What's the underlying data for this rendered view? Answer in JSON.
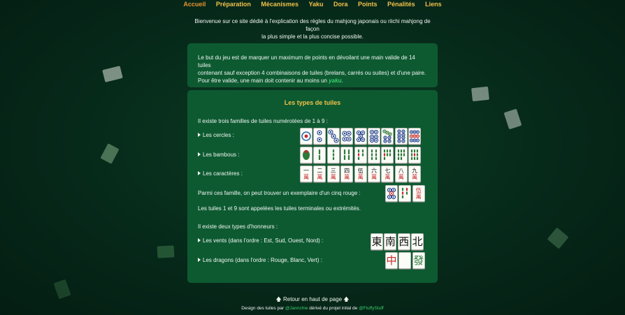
{
  "nav": [
    {
      "label": "Accueil",
      "active": true
    },
    {
      "label": "Préparation"
    },
    {
      "label": "Mécanismes"
    },
    {
      "label": "Yaku"
    },
    {
      "label": "Dora"
    },
    {
      "label": "Points"
    },
    {
      "label": "Pénalités"
    },
    {
      "label": "Liens"
    }
  ],
  "intro": {
    "line1": "Bienvenue sur ce site dédié à l'explication des règles du mahjong japonais ou riichi mahjong de façon",
    "line2": "la plus simple et la plus concise possible."
  },
  "goal": {
    "line1": "Le but du jeu est de marquer un maximum de points en dévoilant une main valide de 14 tuiles",
    "line2": "contenant sauf exception 4 combinaisons de tuiles (brelans, carrés ou suites) et d'une paire.",
    "line3_before": "Pour être valide, une main doit contenir au moins un ",
    "line3_yaku": "yaku",
    "line3_after": "."
  },
  "tiles_section": {
    "title": "Les types de tuiles",
    "families_intro": "Il existe trois familles de tuiles numérotées de 1 à 9 :",
    "circles_label": "Les cercles :",
    "bamboos_label": "Les bambous :",
    "characters_label": "Les caractères :",
    "red_five_text": "Parmi ces famille, on peut trouver un exemplaire d'un cinq rouge :",
    "terminals_text": "Les tuiles 1 et 9 sont appelées les tuiles terminales ou extrémités.",
    "honors_intro": "Il existe deux types d'honneurs :",
    "winds_label": "Les vents (dans l'ordre : Est, Sud, Ouest, Nord) :",
    "dragons_label": "Les dragons (dans l'ordre : Rouge, Blanc, Vert) :",
    "character_numerals": [
      "一",
      "二",
      "三",
      "四",
      "伍",
      "六",
      "七",
      "八",
      "九"
    ],
    "character_suffix": "萬",
    "red_five_character": "伍",
    "winds": [
      "東",
      "南",
      "西",
      "北"
    ],
    "dragons": [
      "中",
      "",
      "發"
    ]
  },
  "footer": {
    "back_to_top": "🡅 Retour en haut de page 🡅",
    "credits_before": "Design des tuiles par ",
    "credits_author1": "@Jannchie",
    "credits_middle": " dérivé du projet inital de ",
    "credits_author2": "@FluffyStuff"
  },
  "colors": {
    "background": "#06291a",
    "panel": "#0d5a31",
    "accent": "#f2c14a",
    "active_nav": "#e6952e",
    "link": "#3bd06c"
  }
}
